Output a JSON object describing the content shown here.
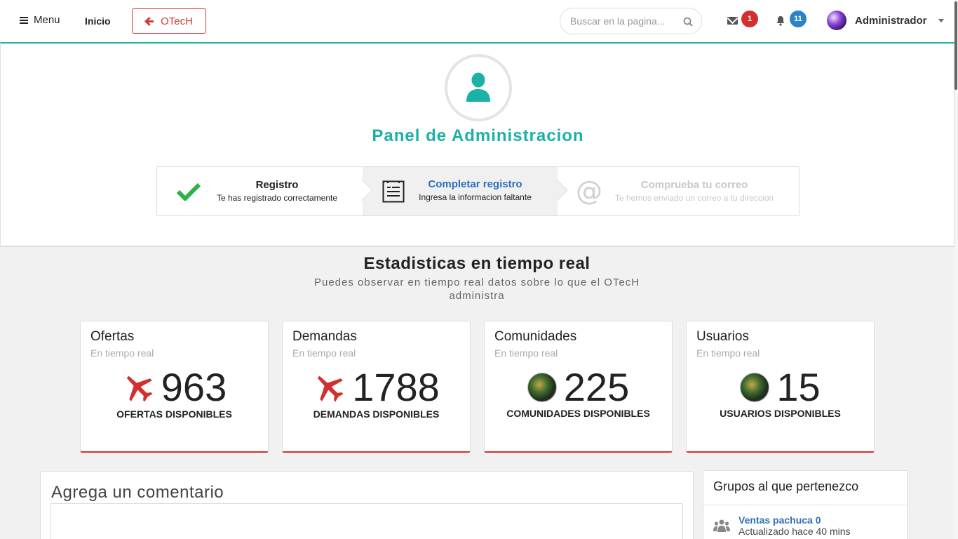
{
  "header": {
    "menu_label": "Menu",
    "home_label": "Inicio",
    "back_button_label": "OTecH",
    "search_placeholder": "Buscar en la pagina...",
    "messages_count": "1",
    "notifications_count": "11",
    "user_name": "Administrador"
  },
  "panel": {
    "title": "Panel de Administracion",
    "steps": [
      {
        "title": "Registro",
        "desc": "Te has registrado correctamente",
        "icon": "check-icon",
        "state": "done"
      },
      {
        "title": "Completar registro",
        "desc": "Ingresa la informacion faltante",
        "icon": "form-icon",
        "state": "active"
      },
      {
        "title": "Comprueba tu correo",
        "desc": "Te hemos enviado un correo a tu direccion",
        "icon": "at-icon",
        "state": "pending"
      }
    ]
  },
  "stats": {
    "title": "Estadisticas en tiempo real",
    "subtitle": "Puedes observar en tiempo real datos sobre lo que el OTecH administra",
    "cards": [
      {
        "title": "Ofertas",
        "sub": "En tiempo real",
        "value": "963",
        "label": "OFERTAS DISPONIBLES",
        "icon": "plane-icon"
      },
      {
        "title": "Demandas",
        "sub": "En tiempo real",
        "value": "1788",
        "label": "DEMANDAS DISPONIBLES",
        "icon": "plane-icon"
      },
      {
        "title": "Comunidades",
        "sub": "En tiempo real",
        "value": "225",
        "label": "COMUNIDADES DISPONIBLES",
        "icon": "community-image"
      },
      {
        "title": "Usuarios",
        "sub": "En tiempo real",
        "value": "15",
        "label": "USUARIOS DISPONIBLES",
        "icon": "users-image"
      }
    ]
  },
  "comment": {
    "title": "Agrega un comentario"
  },
  "groups": {
    "title": "Grupos al que pertenezco",
    "items": [
      {
        "name": "Ventas pachuca 0",
        "meta": "Actualizado hace 40 mins",
        "icon": "group-icon"
      }
    ]
  },
  "colors": {
    "accent": "#1ab1a7",
    "danger": "#d32f2f",
    "link": "#2f6fb7",
    "success": "#2db24a"
  }
}
